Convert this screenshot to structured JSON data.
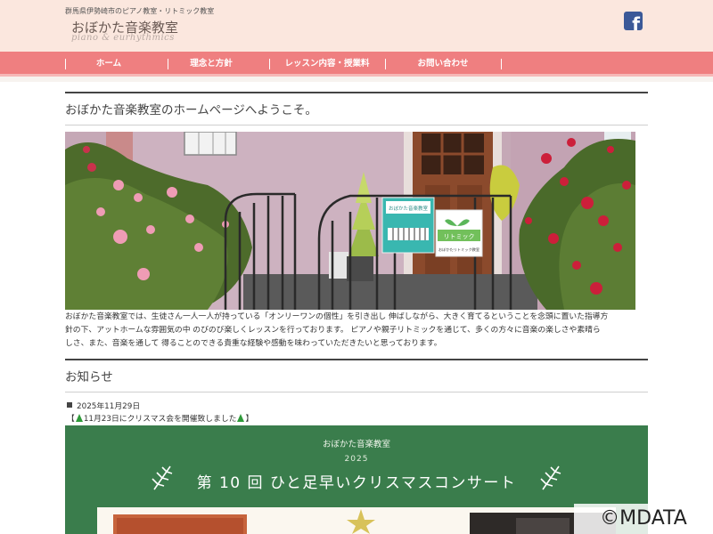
{
  "header": {
    "tagline": "群馬県伊勢崎市のピアノ教室・リトミック教室",
    "logo_title": "おぼかた音楽教室",
    "logo_subtitle": "piano & eurhythmics"
  },
  "nav": {
    "items": [
      {
        "label": "ホーム"
      },
      {
        "label": "理念と方針"
      },
      {
        "label": "レッスン内容・授業料"
      },
      {
        "label": "お問い合わせ"
      }
    ]
  },
  "welcome": {
    "heading": "おぼかた音楽教室のホームページへようこそ。"
  },
  "photo": {
    "sign_name": "おぼかた音楽教室",
    "sign_rhythmic": "リトミック",
    "sign_rhythmic_sub": "おぼかたリトミック教室"
  },
  "intro": {
    "lines": [
      "おぼかた音楽教室では、生徒さん一人一人が持っている「オンリーワンの個性」を引き出し 伸ばしながら、大きく育てるということを念頭に置いた指導方",
      "針の下、アットホームな雰囲気の中 のびのび楽しくレッスンを行っております。 ピアノや親子リトミックを通じて、多くの方々に音楽の楽しさや素晴ら",
      "しさ、また、音楽を通して 得ることのできる貴重な経験や感動を味わっていただきたいと思っております。"
    ]
  },
  "news": {
    "heading": "お知らせ",
    "date": "2025年11月29日",
    "title_open": "【",
    "title_text": "11月23日にクリスマス会を開催致しました",
    "title_close": "】"
  },
  "banner": {
    "organizer": "おぼかた音楽教室",
    "year": "2025",
    "title": "第 10 回  ひと足早いクリスマスコンサート"
  },
  "watermark": "©MDATA",
  "colors": {
    "header_bg": "#fbe7de",
    "nav_bg": "#ef7f80",
    "banner_bg": "#3a7d4c",
    "facebook": "#3b5998"
  }
}
